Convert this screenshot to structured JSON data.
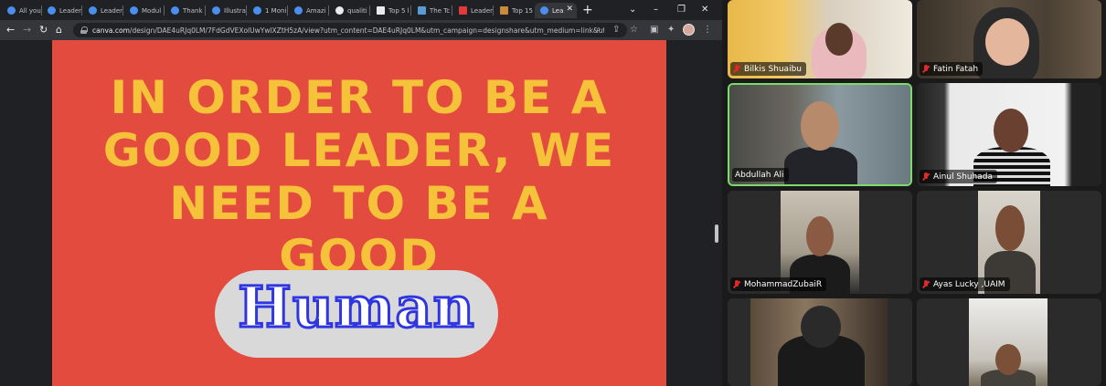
{
  "browser": {
    "tabs": [
      {
        "label": "All you",
        "color": "#4a8ff0"
      },
      {
        "label": "Leader",
        "color": "#4a8ff0"
      },
      {
        "label": "Leader",
        "color": "#4a8ff0"
      },
      {
        "label": "Modul",
        "color": "#4a8ff0"
      },
      {
        "label": "Thank",
        "color": "#4a8ff0"
      },
      {
        "label": "Illustra",
        "color": "#4a8ff0"
      },
      {
        "label": "1 Moni",
        "color": "#4a8ff0"
      },
      {
        "label": "Amazi",
        "color": "#4a8ff0"
      },
      {
        "label": "qualiti",
        "color": "#e8eaed"
      },
      {
        "label": "Top 5 l",
        "color": "#e8eaed"
      },
      {
        "label": "The Tc",
        "color": "#5a9bd5"
      },
      {
        "label": "Leader",
        "color": "#e03a3a"
      },
      {
        "label": "Top 15",
        "color": "#c98a3a"
      },
      {
        "label": "Lea",
        "color": "#4a8ff0",
        "active": true
      }
    ],
    "url_host": "canva.com",
    "url_rest": "/design/DAE4uRJq0LM/7FdGdVEXolUwYwlXZtH5zA/view?utm_content=DAE4uRJq0LM&utm_campaign=designshare&utm_medium=link&ut..."
  },
  "slide": {
    "line1": "IN ORDER TO BE A",
    "line2": "GOOD LEADER, WE",
    "line3": "NEED TO BE A",
    "line4": "GOOD",
    "emphasis": "Human",
    "background_color": "#e34b3e",
    "text_color": "#f5c23a"
  },
  "participants": [
    {
      "name": "Bilkis Shuaibu",
      "speaking": false
    },
    {
      "name": "Fatin Fatah",
      "speaking": false
    },
    {
      "name": "Abdullah Ali",
      "speaking": true
    },
    {
      "name": "Ainul Shuhada",
      "speaking": false
    },
    {
      "name": "MohammadZubaiR",
      "speaking": false
    },
    {
      "name": "Ayas Lucky ,UAIM",
      "speaking": false
    },
    {
      "name": "",
      "speaking": false
    },
    {
      "name": "",
      "speaking": false
    }
  ]
}
